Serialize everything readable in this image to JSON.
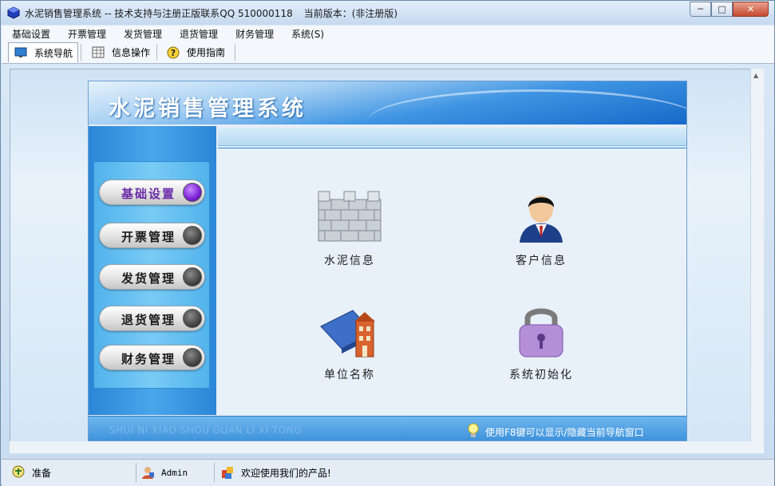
{
  "window": {
    "title": "水泥销售管理系统 -- 技术支持与注册正版联系QQ 510000118",
    "version": "当前版本：(非注册版)",
    "controls": {
      "minimize": "─",
      "maximize": "□",
      "close": "✕"
    }
  },
  "menu": [
    "基础设置",
    "开票管理",
    "发货管理",
    "退货管理",
    "财务管理",
    "系统(S)"
  ],
  "tabs": [
    {
      "label": "系统导航",
      "icon": "monitor-icon",
      "active": true
    },
    {
      "label": "信息操作",
      "icon": "grid-icon",
      "active": false
    },
    {
      "label": "使用指南",
      "icon": "help-icon",
      "active": false
    }
  ],
  "navigator": {
    "banner_title": "水泥销售管理系统",
    "sidebar": [
      {
        "label": "基础设置",
        "active": true
      },
      {
        "label": "开票管理",
        "active": false
      },
      {
        "label": "发货管理",
        "active": false
      },
      {
        "label": "退货管理",
        "active": false
      },
      {
        "label": "财务管理",
        "active": false
      }
    ],
    "items": [
      {
        "label": "水泥信息",
        "icon": "wall-icon"
      },
      {
        "label": "客户信息",
        "icon": "person-icon"
      },
      {
        "label": "单位名称",
        "icon": "building-icon"
      },
      {
        "label": "系统初始化",
        "icon": "lock-icon"
      }
    ],
    "footer_pinyin": "SHUI NI XIAO SHOU GUAN LI XI TONG",
    "footer_tip": "使用F8键可以显示/隐藏当前导航窗口"
  },
  "status": {
    "state": "准备",
    "user": "Admin",
    "message": "欢迎使用我们的产品!"
  },
  "colors": {
    "accent": "#2b86d8",
    "active_dot": "#7a1fd6"
  }
}
